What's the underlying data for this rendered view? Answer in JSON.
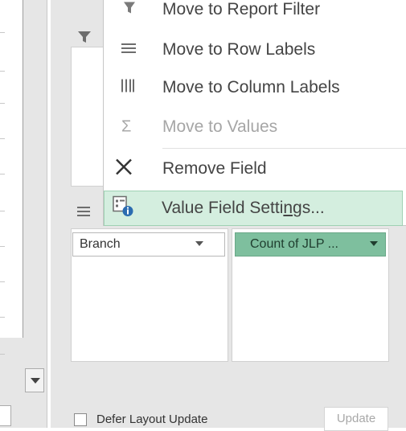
{
  "context_menu": {
    "items": [
      {
        "label": "Move to Report Filter",
        "icon": "funnel-icon",
        "enabled": true
      },
      {
        "label": "Move to Row Labels",
        "icon": "rows-icon",
        "enabled": true
      },
      {
        "label": "Move to Column Labels",
        "icon": "columns-icon",
        "enabled": true
      },
      {
        "label": "Move to Values",
        "icon": "sigma-icon",
        "enabled": false
      },
      {
        "label": "Remove Field",
        "icon": "close-icon",
        "enabled": true
      },
      {
        "label_before": "Value Field Setti",
        "label_accel": "n",
        "label_after": "gs...",
        "icon": "field-settings-icon",
        "enabled": true,
        "highlighted": true
      }
    ]
  },
  "pivot_pane": {
    "rows_field": "Branch",
    "values_field": "Count of JLP ...",
    "defer_label": "Defer Layout Update",
    "defer_checked": false,
    "update_label": "Update"
  },
  "colors": {
    "highlight": "#d4eedf",
    "values_pill": "#7ebf9e",
    "pane_bg": "#e6e6e6"
  }
}
